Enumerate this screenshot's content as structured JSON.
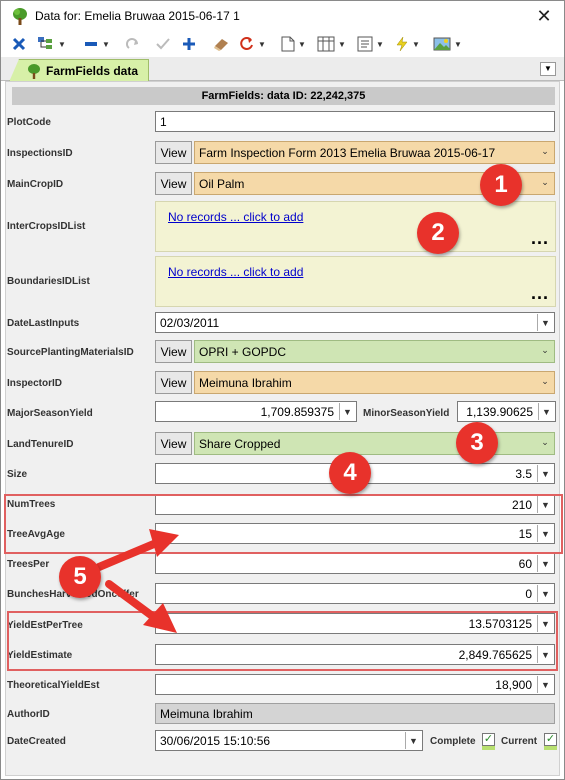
{
  "window": {
    "title": "Data for:  Emelia Bruwaa 2015-06-17 1"
  },
  "tab": {
    "label": "FarmFields data"
  },
  "form": {
    "header": "FarmFields: data ID: 22,242,375",
    "view_label": "View",
    "link_text": "No records ... click to add",
    "dots": "...",
    "fields": {
      "plot_code": {
        "label": "PlotCode",
        "value": "1"
      },
      "inspections_id": {
        "label": "InspectionsID",
        "value": "Farm Inspection Form 2013 Emelia Bruwaa 2015-06-17"
      },
      "main_crop_id": {
        "label": "MainCropID",
        "value": "Oil Palm"
      },
      "inter_crops": {
        "label": "InterCropsIDList"
      },
      "boundaries": {
        "label": "BoundariesIDList"
      },
      "date_last_inputs": {
        "label": "DateLastInputs",
        "value": "02/03/2011"
      },
      "source_planting": {
        "label": "SourcePlantingMaterialsID",
        "value": "OPRI + GOPDC"
      },
      "inspector_id": {
        "label": "InspectorID",
        "value": "Meimuna Ibrahim"
      },
      "major_season_yield": {
        "label": "MajorSeasonYield",
        "value": "1,709.859375"
      },
      "minor_season_yield": {
        "label": "MinorSeasonYield",
        "value": "1,139.90625"
      },
      "land_tenure_id": {
        "label": "LandTenureID",
        "value": "Share Cropped"
      },
      "size": {
        "label": "Size",
        "value": "3.5"
      },
      "num_trees": {
        "label": "NumTrees",
        "value": "210"
      },
      "tree_avg_age": {
        "label": "TreeAvgAge",
        "value": "15"
      },
      "trees_per": {
        "label": "TreesPer",
        "value": "60"
      },
      "bunches": {
        "label": "BunchesHarvestedOnceffer",
        "value": "0"
      },
      "yield_est_per_tree": {
        "label": "YieldEstPerTree",
        "value": "13.5703125"
      },
      "yield_estimate": {
        "label": "YieldEstimate",
        "value": "2,849.765625"
      },
      "theoretical_yield": {
        "label": "TheoreticalYieldEst",
        "value": "18,900"
      },
      "author_id": {
        "label": "AuthorID",
        "value": "Meimuna Ibrahim"
      },
      "date_created": {
        "label": "DateCreated",
        "value": "30/06/2015 15:10:56"
      },
      "complete": {
        "label": "Complete",
        "checked": true
      },
      "current": {
        "label": "Current",
        "checked": true
      }
    }
  },
  "annotations": [
    "1",
    "2",
    "3",
    "4",
    "5"
  ],
  "colors": {
    "tab_green": "#d7f0a8",
    "field_orange": "#f5d9a8",
    "field_green": "#cfe5b4",
    "list_yellow": "#f3f3d3",
    "badge_red": "#e8322b",
    "box_red": "#e06060",
    "toolbar_blue": "#1a5ab8"
  },
  "icons": [
    "tree-icon",
    "close-icon",
    "delete-icon",
    "tree-view-icon",
    "minus-icon",
    "redo-icon",
    "check-icon",
    "add-icon",
    "eraser-icon",
    "refresh-icon",
    "page-icon",
    "grid-icon",
    "form-icon",
    "lightning-icon",
    "picture-icon",
    "menu-icon"
  ]
}
